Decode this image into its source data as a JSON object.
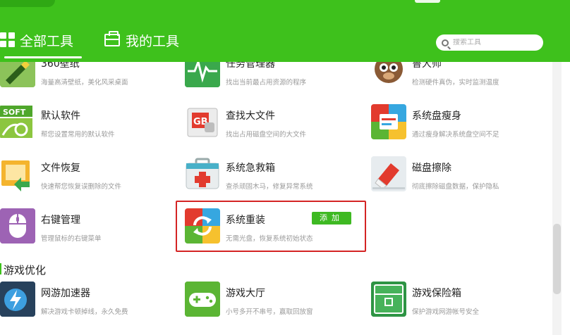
{
  "header": {
    "tabs": [
      {
        "label": "全部工具",
        "active": true
      },
      {
        "label": "我的工具",
        "active": false
      }
    ],
    "search": {
      "placeholder": "搜索工具"
    },
    "accent": "#3ec11c"
  },
  "tools": [
    {
      "name": "360壁纸",
      "desc": "海量高清壁纸，美化风采桌面",
      "icon": "pen-icon"
    },
    {
      "name": "任务管理器",
      "desc": "找出当前最占用资源的程序",
      "icon": "pulse-monitor-icon"
    },
    {
      "name": "鲁大师",
      "desc": "检测硬件真伪，实时监测温度",
      "icon": "master-lu-icon"
    },
    {
      "name": "默认软件",
      "desc": "帮您设置常用的默认软件",
      "icon": "soft-icon"
    },
    {
      "name": "查找大文件",
      "desc": "找出占用磁盘空间的大文件",
      "icon": "gb-file-icon"
    },
    {
      "name": "系统盘瘦身",
      "desc": "通过瘦身解决系统盘空间不足",
      "icon": "disk-slim-icon"
    },
    {
      "name": "文件恢复",
      "desc": "快速帮您恢复误删除的文件",
      "icon": "file-restore-icon"
    },
    {
      "name": "系统急救箱",
      "desc": "查杀顽固木马，修复异常系统",
      "icon": "first-aid-kit-icon"
    },
    {
      "name": "磁盘擦除",
      "desc": "彻底擦除磁盘数据，保护隐私",
      "icon": "eraser-icon"
    },
    {
      "name": "右键管理",
      "desc": "管理鼠标的右键菜单",
      "icon": "mouse-icon"
    },
    {
      "name": "系统重装",
      "desc": "无需光盘，恢复系统初始状态",
      "icon": "reinstall-icon",
      "action": "添加"
    }
  ],
  "game_section": {
    "title": "游戏优化",
    "tools": [
      {
        "name": "网游加速器",
        "desc": "解决游戏卡顿掉线，永久免费",
        "icon": "lightning-shield-icon"
      },
      {
        "name": "游戏大厅",
        "desc": "小号多开不串号，赢取回放窗",
        "icon": "gamepad-icon"
      },
      {
        "name": "游戏保险箱",
        "desc": "保护游戏网游帐号安全",
        "icon": "safe-box-icon"
      }
    ]
  },
  "highlight_color": "#d42424"
}
